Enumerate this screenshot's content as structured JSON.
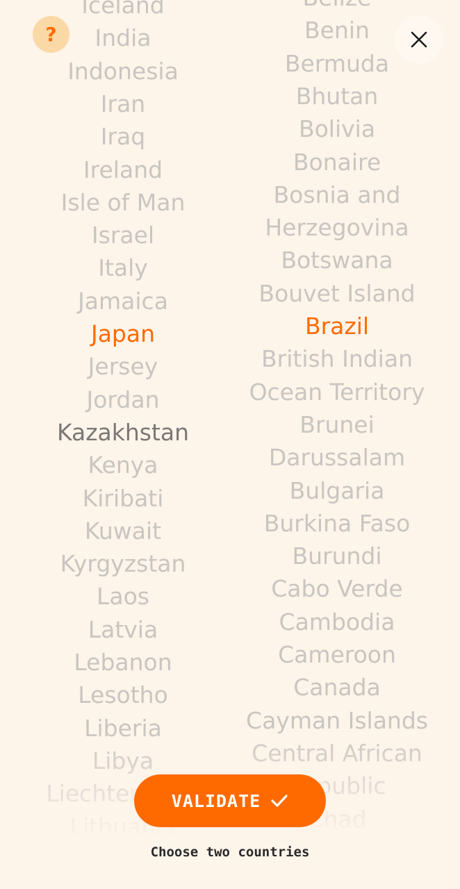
{
  "help_button": {
    "label": "?"
  },
  "close_button": {
    "icon": "close-icon"
  },
  "left_list": {
    "items": [
      "Iceland",
      "India",
      "Indonesia",
      "Iran",
      "Iraq",
      "Ireland",
      "Isle of Man",
      "Israel",
      "Italy",
      "Jamaica",
      "Japan",
      "Jersey",
      "Jordan",
      "Kazakhstan",
      "Kenya",
      "Kiribati",
      "Kuwait",
      "Kyrgyzstan",
      "Laos",
      "Latvia",
      "Lebanon",
      "Lesotho",
      "Liberia",
      "Libya",
      "Liechtenstein",
      "Lithuania"
    ],
    "selected": "Japan",
    "focused": "Kazakhstan"
  },
  "right_list": {
    "items": [
      "Belize",
      "Benin",
      "Bermuda",
      "Bhutan",
      "Bolivia",
      "Bonaire",
      "Bosnia and",
      "Herzegovina",
      "Botswana",
      "Bouvet Island",
      "Brazil",
      "British Indian",
      "Ocean Territory",
      "Brunei",
      "Darussalam",
      "Bulgaria",
      "Burkina Faso",
      "Burundi",
      "Cabo Verde",
      "Cambodia",
      "Cameroon",
      "Canada",
      "Cayman Islands",
      "Central African",
      "Republic",
      "Chad"
    ],
    "selected": "Brazil"
  },
  "validate_button": {
    "label": "VALIDATE",
    "icon": "checkmark-icon"
  },
  "hint": "Choose two countries",
  "colors": {
    "background": "#fdf4ea",
    "accent": "#ff6a00",
    "item_text": "#c9c5c0",
    "focused_text": "#7a7875",
    "help_bg": "#fbd9a6"
  }
}
